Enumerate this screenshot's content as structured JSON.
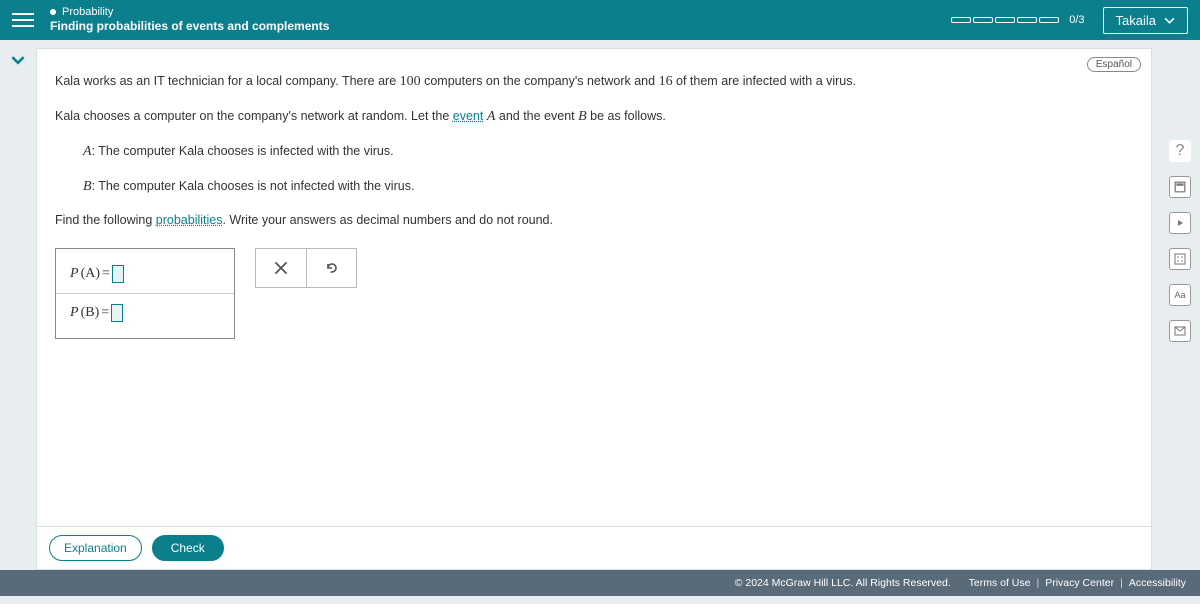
{
  "header": {
    "category": "Probability",
    "title": "Finding probabilities of events and complements",
    "progress_text": "0/3",
    "user_name": "Takaila"
  },
  "language_btn": "Español",
  "problem": {
    "intro1a": "Kala works as an IT technician for a local company. There are ",
    "n_total": "100",
    "intro1b": " computers on the company's network and ",
    "n_infected": "16",
    "intro1c": " of them are infected with a virus.",
    "intro2a": "Kala chooses a computer on the company's network at random. Let the ",
    "link_event": "event",
    "intro2b": " and the event ",
    "intro2c": " be as follows.",
    "def_a": ": The computer Kala chooses is infected with the virus.",
    "def_b": ": The computer Kala chooses is not infected with the virus.",
    "find1": "Find the following ",
    "link_prob": "probabilities",
    "find2": ". Write your answers as decimal numbers and do not round."
  },
  "answers": {
    "pa_label_open": "P",
    "pa_label_arg": "(A)",
    "pb_label_open": "P",
    "pb_label_arg": "(B)",
    "equals": " = "
  },
  "buttons": {
    "explanation": "Explanation",
    "check": "Check"
  },
  "footer": {
    "copyright": "© 2024 McGraw Hill LLC. All Rights Reserved.",
    "terms": "Terms of Use",
    "privacy": "Privacy Center",
    "access": "Accessibility"
  }
}
